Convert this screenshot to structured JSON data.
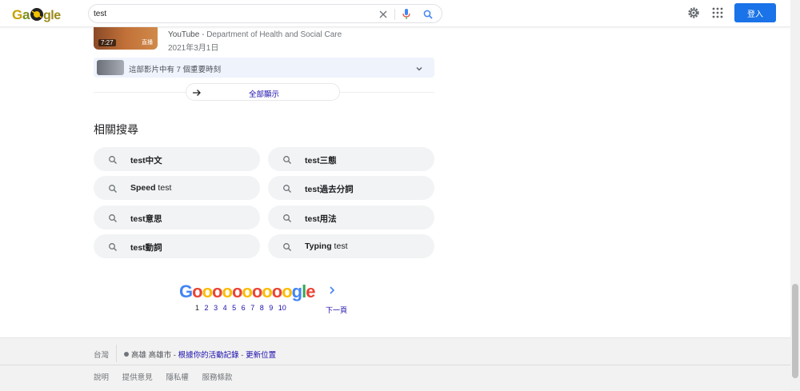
{
  "header": {
    "logo_text": "Google",
    "search_value": "test",
    "signin_label": "登入"
  },
  "video": {
    "duration": "7:27",
    "thumb_tag": "直播",
    "channel": "YouTube",
    "organization": "Department of Health and Social Care",
    "date": "2021年3月1日",
    "moments_label": "這部影片中有 7 個重要時刻",
    "show_all_label": "全部顯示"
  },
  "related": {
    "title": "相關搜尋",
    "chips": [
      {
        "bold": "test中文",
        "plain": ""
      },
      {
        "bold": "test三態",
        "plain": ""
      },
      {
        "bold": "Speed",
        "plain": " test"
      },
      {
        "bold": "test過去分詞",
        "plain": ""
      },
      {
        "bold": "test意思",
        "plain": ""
      },
      {
        "bold": "test用法",
        "plain": ""
      },
      {
        "bold": "test動詞",
        "plain": ""
      },
      {
        "bold": "Typing",
        "plain": " test"
      }
    ]
  },
  "pager": {
    "logo_text": "Goooooooooogle",
    "pages": [
      "1",
      "2",
      "3",
      "4",
      "5",
      "6",
      "7",
      "8",
      "9",
      "10"
    ],
    "current": "1",
    "next_label": "下一頁"
  },
  "footer": {
    "country": "台灣",
    "location": "高雄 高雄市",
    "activity_link": "根據你的活動記錄",
    "update_link": "更新位置",
    "links": [
      "說明",
      "提供意見",
      "隱私權",
      "服務條款"
    ]
  },
  "colors": {
    "blue": "#4285f4",
    "red": "#ea4335",
    "yellow": "#fbbc05",
    "green": "#34a853",
    "link": "#1a0dab",
    "signin_bg": "#1a73e8"
  }
}
